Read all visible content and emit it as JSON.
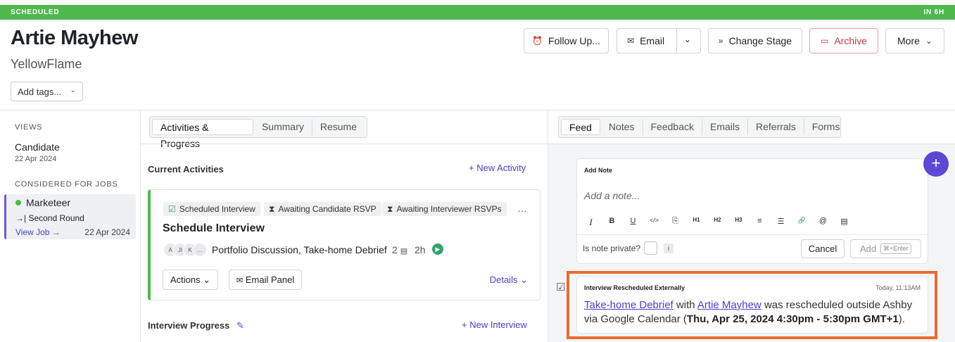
{
  "status_bar": {
    "left": "SCHEDULED",
    "right": "IN 6H",
    "color": "#4fb84d"
  },
  "candidate": {
    "name": "Artie Mayhew",
    "company": "YellowFlame",
    "tags_placeholder": "Add tags..."
  },
  "header_actions": {
    "follow_up": "Follow Up...",
    "email": "Email",
    "change_stage": "Change Stage",
    "archive": "Archive",
    "more": "More"
  },
  "sidebar": {
    "views_heading": "VIEWS",
    "views": [
      {
        "label": "Candidate",
        "date": "22 Apr 2024"
      }
    ],
    "jobs_heading": "CONSIDERED FOR JOBS",
    "job": {
      "title": "Marketeer",
      "stage": "Second Round",
      "link": "View Job →",
      "date": "22 Apr 2024",
      "status_color": "#4fb84d"
    }
  },
  "middle_tabs": [
    "Activities & Progress",
    "Summary",
    "Resume"
  ],
  "activities": {
    "heading": "Current Activities",
    "new_activity": "+ New Activity",
    "card": {
      "chips": [
        "Scheduled Interview",
        "Awaiting Candidate RSVP",
        "Awaiting Interviewer RSVPs"
      ],
      "title": "Schedule Interview",
      "avatars": [
        "A",
        "JI",
        "K"
      ],
      "more_avatars": "…",
      "interviews": "Portfolio Discussion, Take-home Debrief",
      "count": "2",
      "duration": "2h",
      "actions": "Actions",
      "email_panel": "Email Panel",
      "details": "Details"
    },
    "progress_heading": "Interview Progress",
    "new_interview": "+ New Interview"
  },
  "right_tabs": [
    "Feed",
    "Notes",
    "Feedback",
    "Emails",
    "Referrals",
    "Forms"
  ],
  "note": {
    "heading": "Add Note",
    "placeholder": "Add a note...",
    "toolbar": [
      "I",
      "B",
      "U",
      "</>",
      "⎘",
      "H1",
      "H2",
      "H3",
      "≡",
      "☰",
      "🔗",
      "@",
      "▤"
    ],
    "private_label": "Is note private?",
    "info": "i",
    "cancel": "Cancel",
    "add": "Add",
    "shortcut": "⌘+Enter"
  },
  "feed_event": {
    "heading": "Interview Rescheduled Externally",
    "time": "Today, 11:13AM",
    "link1": "Take-home Debrief",
    "text1": " with ",
    "link2": "Artie Mayhew",
    "text2": " was rescheduled outside Ashby via Google Calendar (",
    "bold": "Thu, Apr 25, 2024 4:30pm - 5:30pm GMT+1",
    "text3": ")."
  },
  "fab": "+"
}
